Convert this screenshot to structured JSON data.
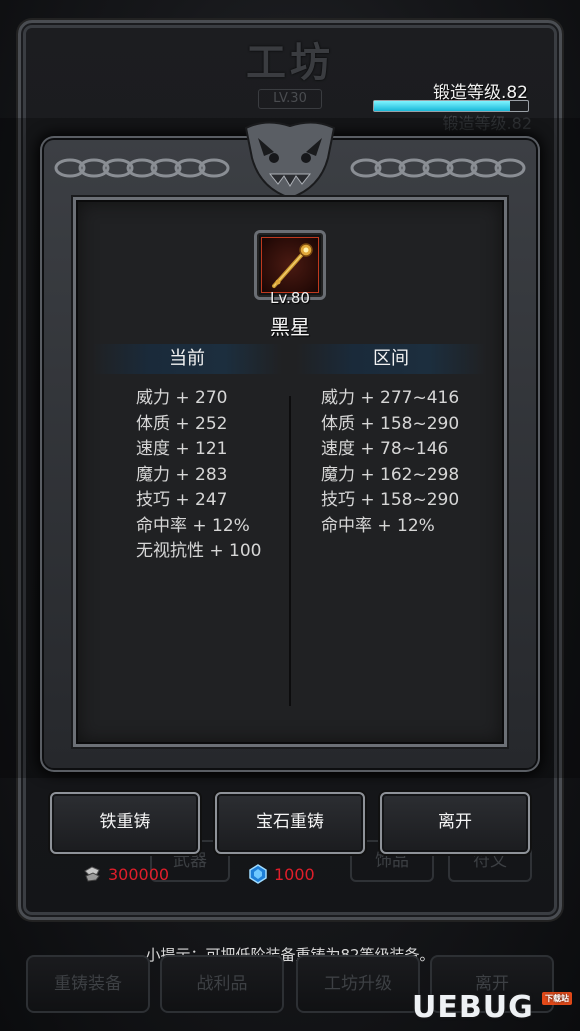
{
  "workshop": {
    "title": "工坊",
    "level_badge": "LV.30",
    "forge_level_label": "锻造等级.82",
    "forge_progress_percent": 88,
    "forge_level_ghost": "锻造等级.82"
  },
  "dialog": {
    "item": {
      "level": "Lv.80",
      "name": "黑星",
      "icon": "golden-staff-icon"
    },
    "columns": {
      "current_header": "当前",
      "range_header": "区间"
    },
    "current_stats": [
      "威力 + 270",
      "体质 + 252",
      "速度 + 121",
      "魔力 + 283",
      "技巧 + 247",
      "命中率 + 12%",
      "无视抗性 + 100"
    ],
    "range_stats": [
      "威力 + 277~416",
      "体质 + 158~290",
      "速度 + 78~146",
      "魔力 + 162~298",
      "技巧 + 158~290",
      "命中率 + 12%"
    ],
    "buttons": {
      "iron_recast": "铁重铸",
      "gem_recast": "宝石重铸",
      "leave": "离开"
    }
  },
  "background_tabs": [
    "武器",
    "饰品",
    "符文"
  ],
  "currency": {
    "iron": "300000",
    "gem": "1000"
  },
  "colors": {
    "currency_text": "#e01e2a",
    "forge_bar": "#18b8d8"
  },
  "hint": "小提示：可把低阶装备重铸为82等级装备。",
  "bottom_nav": [
    "重铸装备",
    "战利品",
    "工坊升级",
    "离开"
  ],
  "watermark": {
    "brand": "UEBUG",
    "tag": "下载站"
  }
}
